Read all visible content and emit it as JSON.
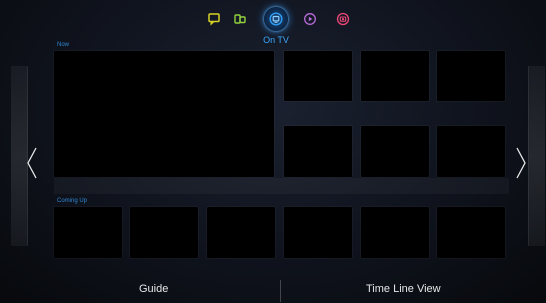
{
  "nav": {
    "items": [
      {
        "icon": "chat-icon",
        "color": "#d7d226"
      },
      {
        "icon": "apps-icon",
        "color": "#93d23d"
      },
      {
        "icon": "tv-icon",
        "color": "#2f9df5"
      },
      {
        "icon": "play-icon",
        "color": "#b86bd9"
      },
      {
        "icon": "camera-icon",
        "color": "#ef4777"
      }
    ],
    "active_label": "On TV"
  },
  "sections": {
    "now_label": "Now",
    "coming_up_label": "Coming Up"
  },
  "bottom": {
    "guide_label": "Guide",
    "timeline_label": "Time Line View"
  }
}
